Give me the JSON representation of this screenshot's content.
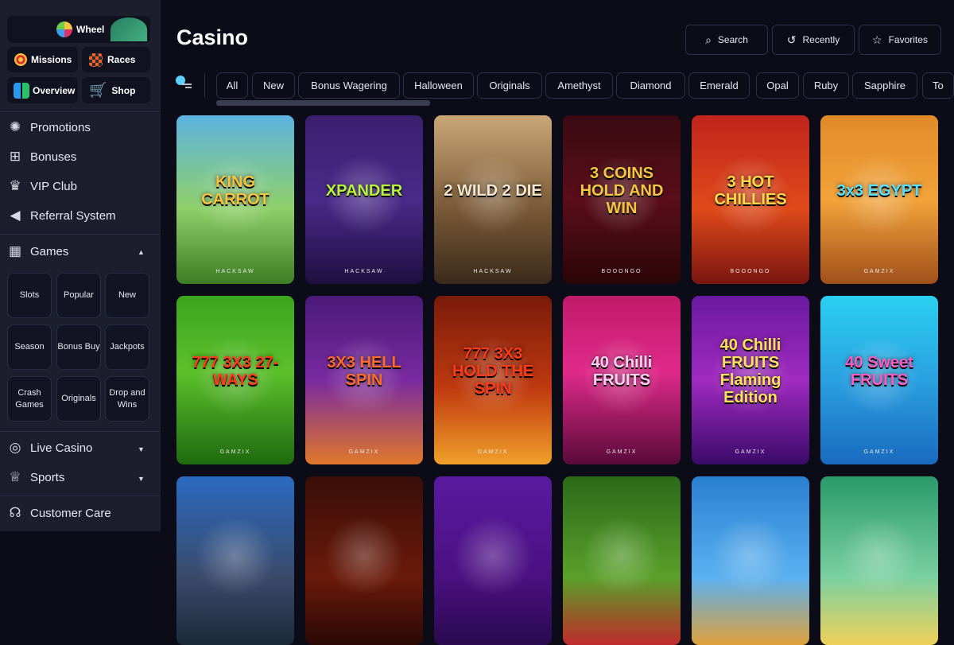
{
  "quick_links": {
    "wheel": "Wheel",
    "missions": "Missions",
    "races": "Races",
    "overview": "Overview",
    "shop": "Shop"
  },
  "nav": {
    "promotions": "Promotions",
    "bonuses": "Bonuses",
    "vip": "VIP Club",
    "referral": "Referral System",
    "games": "Games",
    "live_casino": "Live Casino",
    "sports": "Sports",
    "customer_care": "Customer Care"
  },
  "game_categories": [
    "Slots",
    "Popular",
    "New",
    "Season",
    "Bonus Buy",
    "Jackpots",
    "Crash Games",
    "Originals",
    "Drop and Wins"
  ],
  "page_title": "Casino",
  "toolbar": {
    "search": "Search",
    "recently": "Recently",
    "favorites": "Favorites"
  },
  "filters": [
    "All",
    "New",
    "Bonus Wagering",
    "Halloween",
    "Originals",
    "Amethyst",
    "Diamond",
    "Emerald",
    "Opal",
    "Ruby",
    "Sapphire",
    "To"
  ],
  "games": [
    {
      "name": "KING CARROT",
      "provider": "HACKSAW",
      "bg": "linear-gradient(180deg,#5cb3e0 0%,#8fd06a 55%,#3d7d24 100%)",
      "color": "#f6c33c"
    },
    {
      "name": "XPANDER",
      "provider": "HACKSAW",
      "bg": "linear-gradient(180deg,#3b1f6e 0%,#4a2a8a 50%,#1f0f40 100%)",
      "color": "#b6f33a"
    },
    {
      "name": "2 WILD 2 DIE",
      "provider": "HACKSAW",
      "bg": "linear-gradient(180deg,#caa777 0%,#7a5a38 55%,#3b2a1a 100%)",
      "color": "#f2e6d0"
    },
    {
      "name": "3 COINS HOLD AND WIN",
      "provider": "BOOONGO",
      "bg": "linear-gradient(180deg,#3a0a12 0%,#5a0e1a 50%,#2a0508 100%)",
      "color": "#f5c542"
    },
    {
      "name": "3 HOT CHILLIES",
      "provider": "BOOONGO",
      "bg": "linear-gradient(180deg,#c0241c 0%,#e04a1a 55%,#7a1510 100%)",
      "color": "#ffd84a"
    },
    {
      "name": "3x3 EGYPT",
      "provider": "GAMZIX",
      "bg": "linear-gradient(180deg,#e08a2a 0%,#f2a33a 50%,#a0501a 100%)",
      "color": "#53e0ff"
    },
    {
      "name": "777 3X3 27-WAYS",
      "provider": "GAMZIX",
      "bg": "linear-gradient(180deg,#3aa51e 0%,#5cc02a 45%,#1f6a10 100%)",
      "color": "#ff3a1a"
    },
    {
      "name": "3X3 HELL SPIN",
      "provider": "GAMZIX",
      "bg": "linear-gradient(180deg,#4a1a7a 0%,#7a2aa0 50%,#e0782a 100%)",
      "color": "#ff6a2a"
    },
    {
      "name": "777 3X3 HOLD THE SPIN",
      "provider": "GAMZIX",
      "bg": "linear-gradient(180deg,#7a1a0a 0%,#c03a10 55%,#f0a02a 100%)",
      "color": "#ff3a1a"
    },
    {
      "name": "40 Chilli FRUITS",
      "provider": "GAMZIX",
      "bg": "linear-gradient(180deg,#c01a6a 0%,#e02a8a 45%,#5a0a3a 100%)",
      "color": "#ffd0f0"
    },
    {
      "name": "40 Chilli FRUITS Flaming Edition",
      "provider": "GAMZIX",
      "bg": "linear-gradient(180deg,#6a1aa0 0%,#a02ac0 50%,#3a0a6a 100%)",
      "color": "#ffe05a"
    },
    {
      "name": "40 Sweet FRUITS",
      "provider": "GAMZIX",
      "bg": "linear-gradient(180deg,#2ad0f0 0%,#2aa0e0 50%,#1a6ac0 100%)",
      "color": "#ff5ac0"
    },
    {
      "name": "",
      "provider": "",
      "bg": "linear-gradient(180deg,#2a6ac0 0%,#3a4a6a 60%,#1a2a3a 100%)",
      "color": "#fff"
    },
    {
      "name": "",
      "provider": "",
      "bg": "linear-gradient(180deg,#3a0e08 0%,#6a1a0a 60%,#2a0805 100%)",
      "color": "#fff"
    },
    {
      "name": "",
      "provider": "",
      "bg": "linear-gradient(180deg,#5a1aa0 0%,#4a1080 60%,#2a0a50 100%)",
      "color": "#fff"
    },
    {
      "name": "",
      "provider": "",
      "bg": "linear-gradient(180deg,#2a6a1a 0%,#5aa02a 60%,#c02a2a 100%)",
      "color": "#fff"
    },
    {
      "name": "",
      "provider": "",
      "bg": "linear-gradient(180deg,#2a80d0 0%,#5ab0f0 60%,#e0a03a 100%)",
      "color": "#fff"
    },
    {
      "name": "",
      "provider": "",
      "bg": "linear-gradient(180deg,#2a9a6a 0%,#7ad0a0 60%,#f0d05a 100%)",
      "color": "#fff"
    }
  ]
}
